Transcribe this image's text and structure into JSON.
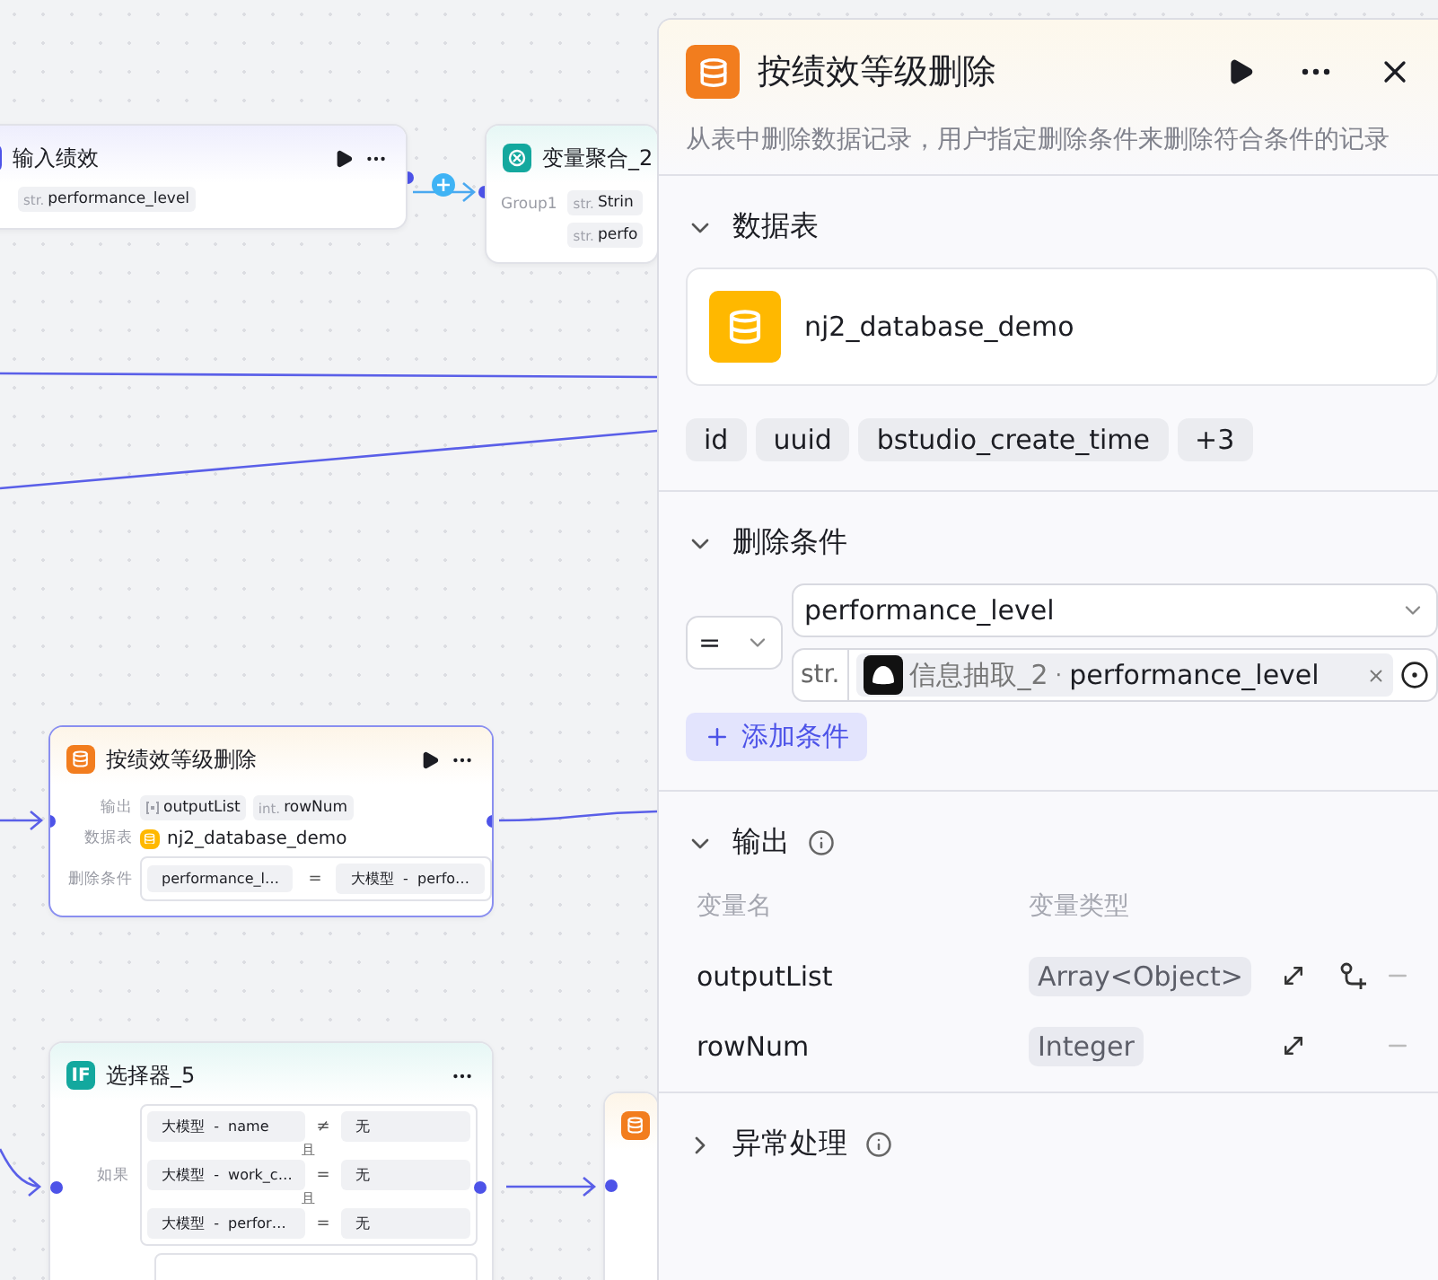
{
  "canvas": {
    "nodes": [
      {
        "kind": "input",
        "title": "输入绩效",
        "outputs": [
          {
            "type": "str.",
            "name": "performance_level"
          }
        ]
      },
      {
        "kind": "aggregate",
        "title": "变量聚合_2",
        "group": "Group1",
        "vars": [
          {
            "type": "str.",
            "name": "Strin"
          },
          {
            "type": "str.",
            "name": "perfo"
          }
        ]
      },
      {
        "kind": "delete",
        "title": "按绩效等级删除",
        "selected": true,
        "output_label": "输出",
        "outputs": [
          {
            "kind": "array",
            "name": "outputList"
          },
          {
            "kind": "typed",
            "type": "int.",
            "name": "rowNum"
          }
        ],
        "table_label": "数据表",
        "table": "nj2_database_demo",
        "condition_label": "删除条件",
        "condition": {
          "left": "performance_l…",
          "op": "=",
          "right": "大模型  -  perfo…"
        }
      },
      {
        "kind": "selector",
        "title": "选择器_5",
        "icon_text": "IF",
        "if_label": "如果",
        "conditions": [
          {
            "left": "大模型  -  name",
            "op": "≠",
            "right": "无"
          },
          {
            "joiner": "且",
            "left": "大模型  -  work_c…",
            "op": "=",
            "right": "无"
          },
          {
            "joiner": "且",
            "left": "大模型  -  perfor…",
            "op": "=",
            "right": "无"
          }
        ]
      },
      {
        "kind": "stub"
      }
    ]
  },
  "panel": {
    "title": "按绩效等级删除",
    "description": "从表中删除数据记录，用户指定删除条件来删除符合条件的记录",
    "sections": [
      {
        "kind": "table",
        "title": "数据表",
        "expanded": true,
        "table": "nj2_database_demo",
        "fields": [
          "id",
          "uuid",
          "bstudio_create_time",
          "+3"
        ]
      },
      {
        "kind": "conditions",
        "title": "删除条件",
        "expanded": true,
        "operator": "=",
        "field": "performance_level",
        "value_type": "str.",
        "value_source": "信息抽取_2",
        "separator": "·",
        "value_name": "performance_level",
        "add_button": "添加条件"
      },
      {
        "kind": "outputs",
        "title": "输出",
        "expanded": true,
        "info": true,
        "columns": [
          "变量名",
          "变量类型"
        ],
        "rows": [
          {
            "name": "outputList",
            "type": "Array<Object>",
            "can_add_child": true
          },
          {
            "name": "rowNum",
            "type": "Integer",
            "can_add_child": false
          }
        ]
      },
      {
        "kind": "error",
        "title": "异常处理",
        "expanded": false,
        "info": true
      }
    ]
  }
}
